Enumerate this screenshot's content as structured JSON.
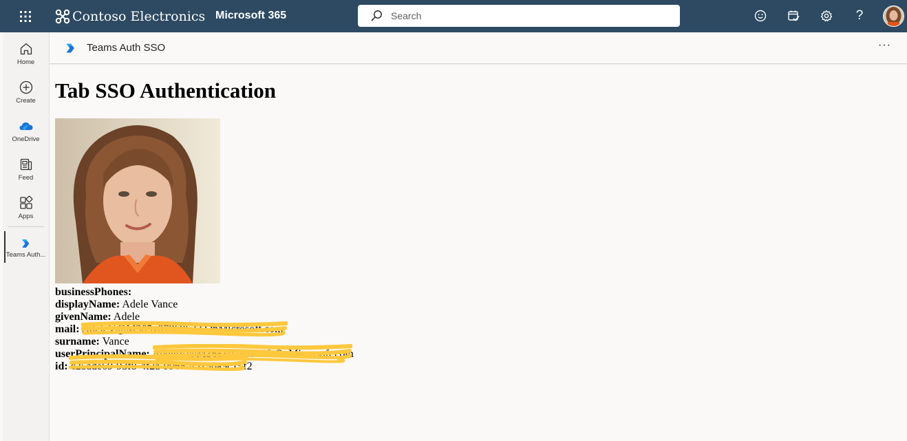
{
  "suite": {
    "org_name": "Contoso Electronics",
    "product_name": "Microsoft 365",
    "search_placeholder": "Search",
    "icons": [
      "waffle-icon",
      "smiley-icon",
      "calendar-check-icon",
      "gear-icon",
      "help-icon"
    ],
    "help_label": "?"
  },
  "rail": {
    "items": [
      {
        "label": "Home",
        "icon": "home-icon"
      },
      {
        "label": "Create",
        "icon": "plus-circle-icon"
      },
      {
        "label": "OneDrive",
        "icon": "cloud-icon"
      },
      {
        "label": "Feed",
        "icon": "feed-icon"
      },
      {
        "label": "Apps",
        "icon": "apps-icon"
      },
      {
        "label": "Teams Auth...",
        "icon": "teams-app-icon",
        "active": true
      }
    ]
  },
  "app_header": {
    "title": "Teams Auth SSO",
    "more_label": "···"
  },
  "page": {
    "title": "Tab SSO Authentication",
    "profile": [
      {
        "key": "businessPhones:",
        "value": ""
      },
      {
        "key": "displayName:",
        "value": "Adele Vance"
      },
      {
        "key": "givenName:",
        "value": "Adele"
      },
      {
        "key": "mail:",
        "value": "AdeleV@M365x07869632.OnMicrosoft.com",
        "redacted": true
      },
      {
        "key": "surname:",
        "value": "Vance"
      },
      {
        "key": "userPrincipalName:",
        "value": "AdeleV@M365x07869632.OnMicrosoft.com",
        "redacted": true
      },
      {
        "key": "id:",
        "value": "c25ade69-93f8-4f2a-9965-45198a9c15f2",
        "redacted": true
      }
    ]
  },
  "colors": {
    "suite_bar": "#2d4a62",
    "redaction": "#ffc83d",
    "rail_bg": "#f3f2f1",
    "page_bg": "#faf9f8"
  }
}
